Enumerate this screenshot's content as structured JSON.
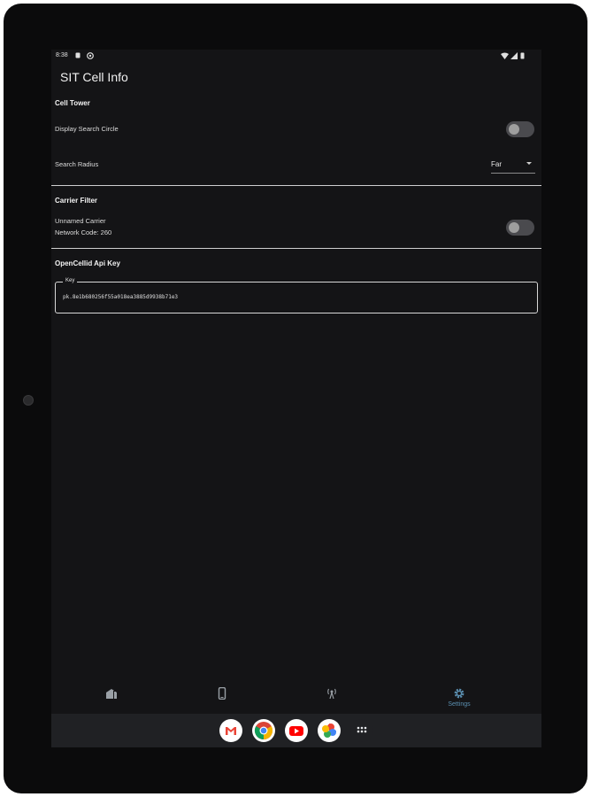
{
  "status_bar": {
    "time": "8:38",
    "icons": [
      "notification-icon",
      "app-badge-icon",
      "wifi-icon",
      "signal-icon",
      "battery-icon"
    ]
  },
  "app": {
    "title": "SIT Cell Info"
  },
  "cell_tower": {
    "title": "Cell Tower",
    "display_search_circle": {
      "label": "Display Search Circle",
      "enabled": false
    },
    "search_radius": {
      "label": "Search Radius",
      "value": "Far"
    }
  },
  "carrier_filter": {
    "title": "Carrier Filter",
    "carrier": {
      "line1": "Unnamed Carrier",
      "line2": "Network Code: 260",
      "enabled": false
    }
  },
  "opencellid": {
    "title": "OpenCellid Api Key",
    "field_label": "Key",
    "value": "pk.8e1b680256f55a018ea3885d9938b71e3"
  },
  "bottom_nav": {
    "items": [
      {
        "icon": "cell-tower-map-icon",
        "label": ""
      },
      {
        "icon": "phone-icon",
        "label": ""
      },
      {
        "icon": "antenna-icon",
        "label": ""
      },
      {
        "icon": "gear-icon",
        "label": "Settings"
      }
    ],
    "active_index": 3,
    "active_color": "#5b8fb0"
  },
  "taskbar": {
    "apps": [
      "gmail-icon",
      "chrome-icon",
      "youtube-icon",
      "photos-icon",
      "app-drawer-icon"
    ]
  }
}
